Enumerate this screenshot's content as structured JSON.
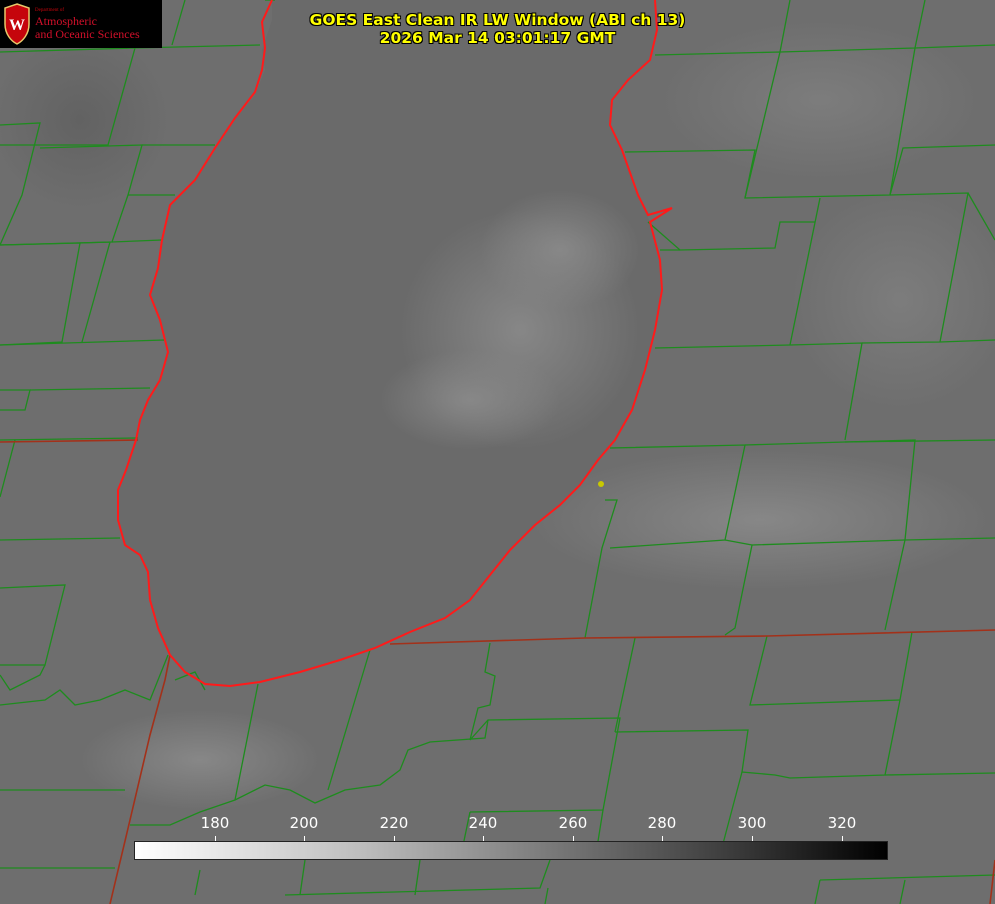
{
  "title": {
    "line1": "GOES East Clean IR LW Window (ABI ch 13)",
    "line2": "2026 Mar 14 03:01:17 GMT"
  },
  "logo": {
    "department": "Department of",
    "line1": "Atmospheric",
    "line2": "and Oceanic Sciences",
    "crest_letter": "W"
  },
  "colorbar": {
    "tick_labels": [
      "180",
      "200",
      "220",
      "240",
      "260",
      "280",
      "300",
      "320"
    ],
    "gradient": "white-to-black"
  },
  "colors": {
    "county_lines": "#1e8c1e",
    "coastline": "#ff1a1a",
    "title_text": "#ffff00",
    "marker": "#c8c800"
  },
  "map": {
    "feature": "lake",
    "marker": "station-dot"
  }
}
